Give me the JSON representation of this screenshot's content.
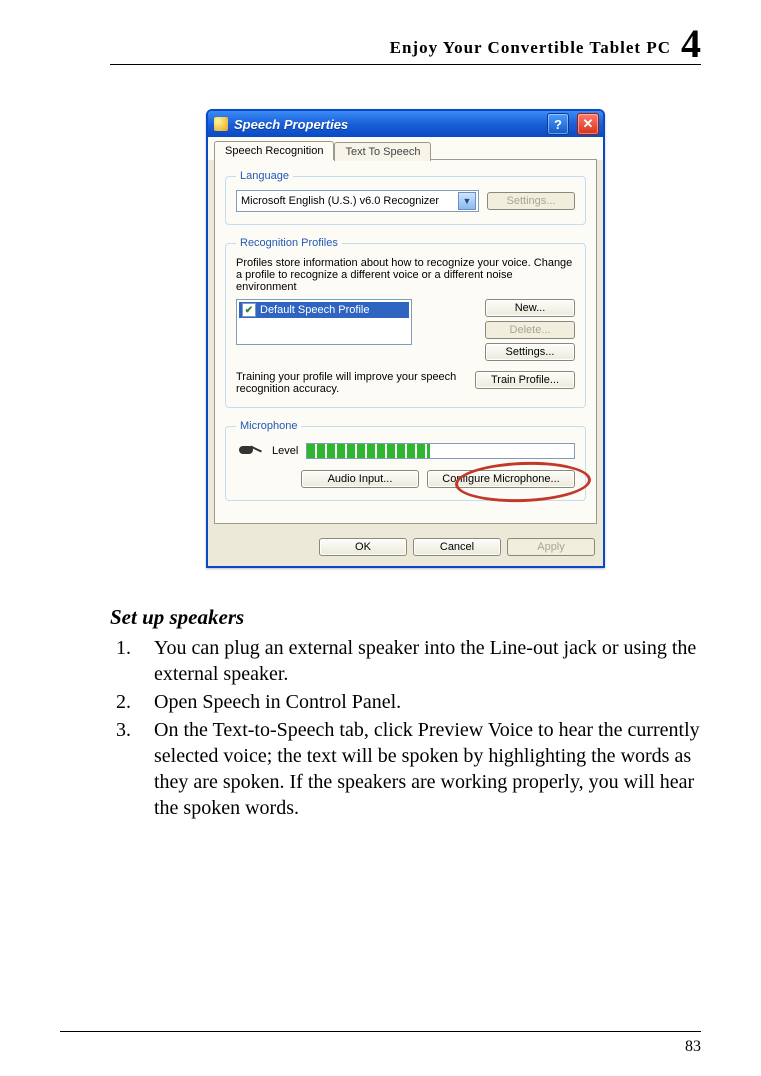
{
  "header": {
    "title": "Enjoy Your Convertible Tablet PC",
    "chapter": "4"
  },
  "page_number": "83",
  "dialog": {
    "title": "Speech Properties",
    "help_btn": "?",
    "close_btn": "✕",
    "tabs": {
      "recognition": "Speech Recognition",
      "tts": "Text To Speech"
    },
    "language": {
      "legend": "Language",
      "combo_value": "Microsoft English (U.S.) v6.0 Recognizer",
      "settings_btn": "Settings..."
    },
    "profiles": {
      "legend": "Recognition Profiles",
      "desc": "Profiles store information about how to recognize your voice. Change a profile to recognize a different voice or a different noise environment",
      "selected": "Default Speech Profile",
      "new_btn": "New...",
      "delete_btn": "Delete...",
      "settings_btn": "Settings...",
      "train_desc": "Training your profile will improve your speech recognition accuracy.",
      "train_btn": "Train Profile..."
    },
    "mic": {
      "legend": "Microphone",
      "level_label": "Level",
      "audio_btn": "Audio Input...",
      "config_btn": "Configure Microphone..."
    },
    "actions": {
      "ok": "OK",
      "cancel": "Cancel",
      "apply": "Apply"
    }
  },
  "section": {
    "heading": "Set up speakers",
    "step1": "You can plug an external speaker into the Line-out jack or using the external speaker.",
    "step2": "Open Speech in Control Panel.",
    "step3": "On the Text-to-Speech tab, click Preview Voice to hear the currently selected voice; the text will be spoken by highlighting the words as they are spoken. If the speakers are working properly, you will hear the spoken words."
  }
}
